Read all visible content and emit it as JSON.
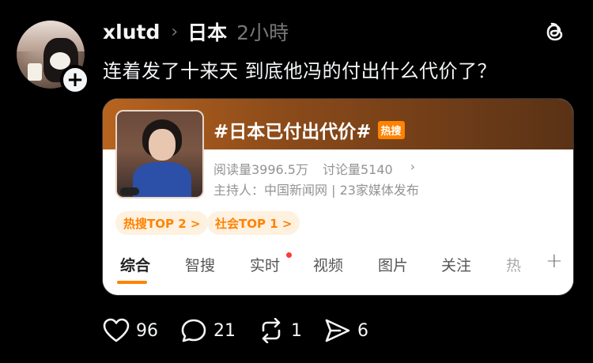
{
  "post": {
    "username": "xlutd",
    "topic": "日本",
    "time": "2小時",
    "text": "连着发了十来天 到底他冯的付出什么代价了？"
  },
  "card": {
    "title": "#日本已付出代价#",
    "hot_badge": "热搜",
    "reads": "阅读量3996.5万",
    "discussions": "讨论量5140",
    "host": "主持人：中国新闻网 | 23家媒体发布",
    "pills": [
      "热搜TOP 2 >",
      "社会TOP 1 >"
    ],
    "tabs": [
      "综合",
      "智搜",
      "实时",
      "视频",
      "图片",
      "关注",
      "热"
    ],
    "accent": "#ff8200"
  },
  "actions": {
    "likes": "96",
    "comments": "21",
    "reposts": "1",
    "shares": "6"
  }
}
